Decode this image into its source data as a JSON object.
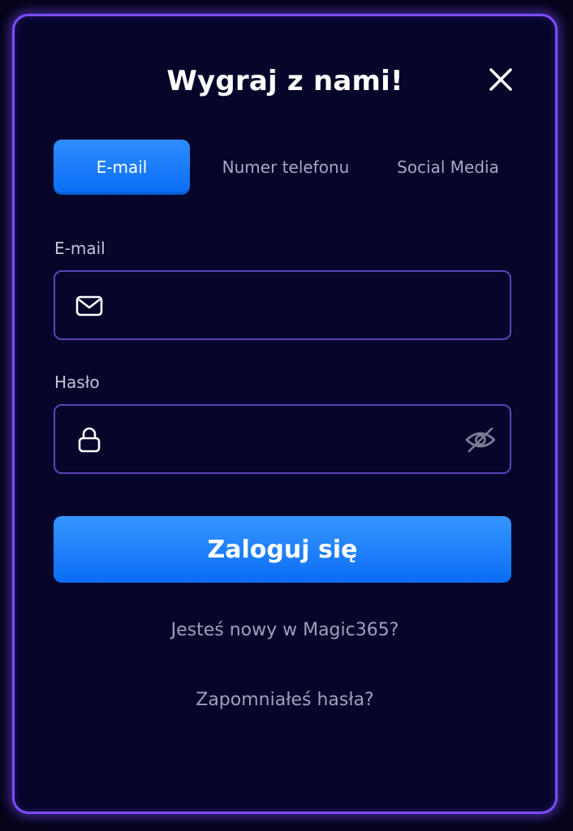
{
  "modal": {
    "title": "Wygraj z nami!",
    "close_icon": "close-icon"
  },
  "tabs": [
    {
      "label": "E-mail",
      "active": true
    },
    {
      "label": "Numer telefonu",
      "active": false
    },
    {
      "label": "Social Media",
      "active": false
    }
  ],
  "form": {
    "email_label": "E-mail",
    "email_value": "",
    "email_placeholder": "",
    "email_icon": "mail-icon",
    "password_label": "Hasło",
    "password_value": "",
    "password_placeholder": "",
    "password_icon": "lock-icon",
    "password_toggle_icon": "eye-off-icon",
    "submit_label": "Zaloguj się"
  },
  "links": {
    "register": "Jesteś nowy w Magic365?",
    "forgot_password": "Zapomniałeś hasła?"
  },
  "colors": {
    "background": "#06052a",
    "border_glow": "#7b4dff",
    "accent_blue": "#0b6df5",
    "field_border": "#5b44b8",
    "muted_text": "#9fa0bd"
  }
}
